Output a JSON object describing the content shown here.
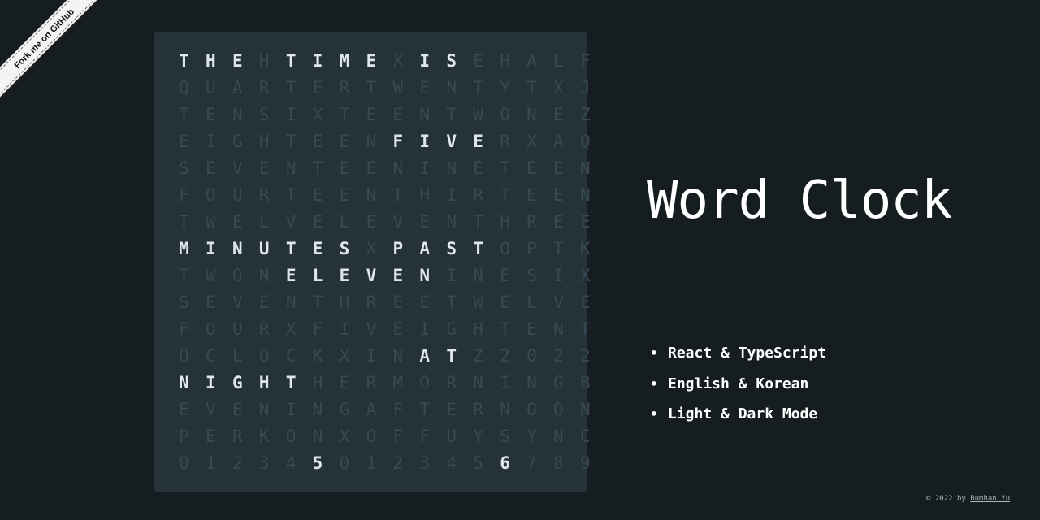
{
  "ribbon": {
    "label": "Fork me on GitHub"
  },
  "clock": {
    "rows": [
      [
        "T",
        "H",
        "E",
        "H",
        "T",
        "I",
        "M",
        "E",
        "X",
        "I",
        "S",
        "E",
        "H",
        "A",
        "L",
        "F"
      ],
      [
        "Q",
        "U",
        "A",
        "R",
        "T",
        "E",
        "R",
        "T",
        "W",
        "E",
        "N",
        "T",
        "Y",
        "T",
        "X",
        "J"
      ],
      [
        "T",
        "E",
        "N",
        "S",
        "I",
        "X",
        "T",
        "E",
        "E",
        "N",
        "T",
        "W",
        "O",
        "N",
        "E",
        "Z"
      ],
      [
        "E",
        "I",
        "G",
        "H",
        "T",
        "E",
        "E",
        "N",
        "F",
        "I",
        "V",
        "E",
        "R",
        "X",
        "A",
        "Q"
      ],
      [
        "S",
        "E",
        "V",
        "E",
        "N",
        "T",
        "E",
        "E",
        "N",
        "I",
        "N",
        "E",
        "T",
        "E",
        "E",
        "N"
      ],
      [
        "F",
        "O",
        "U",
        "R",
        "T",
        "E",
        "E",
        "N",
        "T",
        "H",
        "I",
        "R",
        "T",
        "E",
        "E",
        "N"
      ],
      [
        "T",
        "W",
        "E",
        "L",
        "V",
        "E",
        "L",
        "E",
        "V",
        "E",
        "N",
        "T",
        "H",
        "R",
        "E",
        "E"
      ],
      [
        "M",
        "I",
        "N",
        "U",
        "T",
        "E",
        "S",
        "X",
        "P",
        "A",
        "S",
        "T",
        "O",
        "P",
        "T",
        "K"
      ],
      [
        "T",
        "W",
        "O",
        "N",
        "E",
        "L",
        "E",
        "V",
        "E",
        "N",
        "I",
        "N",
        "E",
        "S",
        "I",
        "X"
      ],
      [
        "S",
        "E",
        "V",
        "E",
        "N",
        "T",
        "H",
        "R",
        "E",
        "E",
        "T",
        "W",
        "E",
        "L",
        "V",
        "E"
      ],
      [
        "F",
        "O",
        "U",
        "R",
        "X",
        "F",
        "I",
        "V",
        "E",
        "I",
        "G",
        "H",
        "T",
        "E",
        "N",
        "T"
      ],
      [
        "O",
        "C",
        "L",
        "O",
        "C",
        "K",
        "X",
        "I",
        "N",
        "A",
        "T",
        "Z",
        "2",
        "0",
        "2",
        "2"
      ],
      [
        "N",
        "I",
        "G",
        "H",
        "T",
        "H",
        "E",
        "R",
        "M",
        "O",
        "R",
        "N",
        "I",
        "N",
        "G",
        "B"
      ],
      [
        "E",
        "V",
        "E",
        "N",
        "I",
        "N",
        "G",
        "A",
        "F",
        "T",
        "E",
        "R",
        "N",
        "O",
        "O",
        "N"
      ],
      [
        "P",
        "E",
        "R",
        "K",
        "O",
        "N",
        "X",
        "O",
        "F",
        "F",
        "U",
        "Y",
        "S",
        "Y",
        "N",
        "C"
      ],
      [
        "0",
        "1",
        "2",
        "3",
        "4",
        "5",
        "0",
        "1",
        "2",
        "3",
        "4",
        "5",
        "6",
        "7",
        "8",
        "9"
      ]
    ],
    "lit": [
      [
        0,
        1,
        2,
        4,
        5,
        6,
        7,
        9,
        10
      ],
      [],
      [],
      [
        8,
        9,
        10,
        11
      ],
      [],
      [],
      [],
      [
        0,
        1,
        2,
        3,
        4,
        5,
        6,
        8,
        9,
        10,
        11
      ],
      [
        4,
        5,
        6,
        7,
        8,
        9
      ],
      [],
      [],
      [
        9,
        10
      ],
      [
        0,
        1,
        2,
        3,
        4
      ],
      [],
      [],
      [
        5,
        12
      ]
    ]
  },
  "title": "Word Clock",
  "features": [
    "React & TypeScript",
    "English & Korean",
    "Light & Dark Mode"
  ],
  "bullet": "•",
  "footer": {
    "prefix": "© 2022 by ",
    "author": "Bumhan Yu"
  }
}
